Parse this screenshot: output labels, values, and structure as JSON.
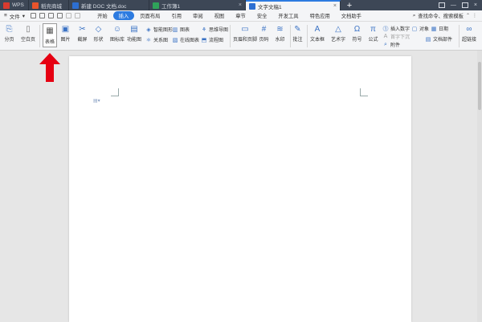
{
  "tabs": [
    {
      "label": "WPS",
      "color": "#d93b2f"
    },
    {
      "label": "稻壳商城",
      "color": "#e8542c"
    },
    {
      "label": "新建 DOC 文档.doc",
      "color": "#2d6fd2"
    },
    {
      "label": "工作簿1",
      "color": "#2fa35a"
    },
    {
      "label": "文字文稿1",
      "color": "#2d6fd2"
    }
  ],
  "tab_close": "×",
  "new_tab": "+",
  "window": {
    "minimize": "—",
    "close": "×"
  },
  "menu": {
    "file": "文件",
    "tabs": [
      "开始",
      "插入",
      "页面布局",
      "引用",
      "审阅",
      "视图",
      "章节",
      "安全",
      "开发工具",
      "特色应用",
      "文档助手"
    ],
    "active_tab": "插入",
    "search": "查找命令、搜索模板"
  },
  "ribbon": {
    "paging": "分页",
    "blank_page": "空白页",
    "table": "表格",
    "picture": "图片",
    "screenshot": "截屏",
    "shape": "形状",
    "icon_lib": "图标库",
    "func_chart": "功能图",
    "smart_shape": "智能图形",
    "chart": "图表",
    "mind_map": "思维导图",
    "relation_chart": "关系图",
    "online_chart": "在线图表",
    "flowchart": "流程图",
    "header_footer": "页眉和页脚",
    "page_number": "页码",
    "watermark": "水印",
    "comment": "批注",
    "textbox": "文本框",
    "art_text": "艺术字",
    "symbol": "符号",
    "formula": "公式",
    "insert_number": "插入数字",
    "first_drop": "首字下沉",
    "attachment": "附件",
    "object": "对象",
    "date": "日期",
    "doc_parts": "文档部件",
    "hyperlink": "超链接"
  },
  "colors": {
    "accent": "#2d7be0",
    "arrow": "#e60012",
    "titlebar": "#3d4756"
  }
}
